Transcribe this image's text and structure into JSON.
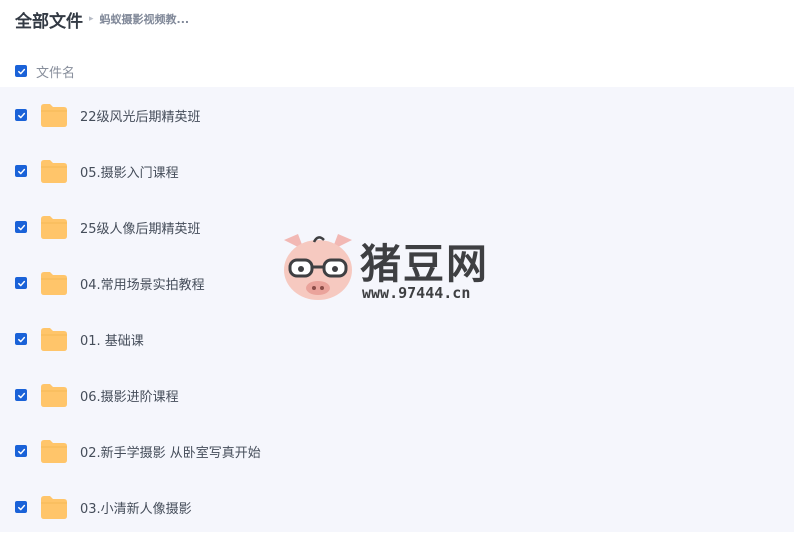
{
  "header": {
    "title": "全部文件",
    "separator": "▸",
    "crumb": "蚂蚁摄影视频教..."
  },
  "column_header": {
    "label": "文件名",
    "checked": true
  },
  "files": [
    {
      "name": "22级风光后期精英班",
      "checked": true,
      "icon": "folder-icon"
    },
    {
      "name": "05.摄影入门课程",
      "checked": true,
      "icon": "folder-icon"
    },
    {
      "name": "25级人像后期精英班",
      "checked": true,
      "icon": "folder-icon"
    },
    {
      "name": "04.常用场景实拍教程",
      "checked": true,
      "icon": "folder-icon"
    },
    {
      "name": "01. 基础课",
      "checked": true,
      "icon": "folder-icon"
    },
    {
      "name": "06.摄影进阶课程",
      "checked": true,
      "icon": "folder-icon"
    },
    {
      "name": "02.新手学摄影 从卧室写真开始",
      "checked": true,
      "icon": "folder-icon"
    },
    {
      "name": "03.小清新人像摄影",
      "checked": true,
      "icon": "folder-icon"
    }
  ],
  "watermark": {
    "title": "猪豆网",
    "url": "www.97444.cn"
  },
  "colors": {
    "accent": "#1a62d8",
    "folder": "#ffc56a",
    "list_bg": "#f5f6fc"
  }
}
